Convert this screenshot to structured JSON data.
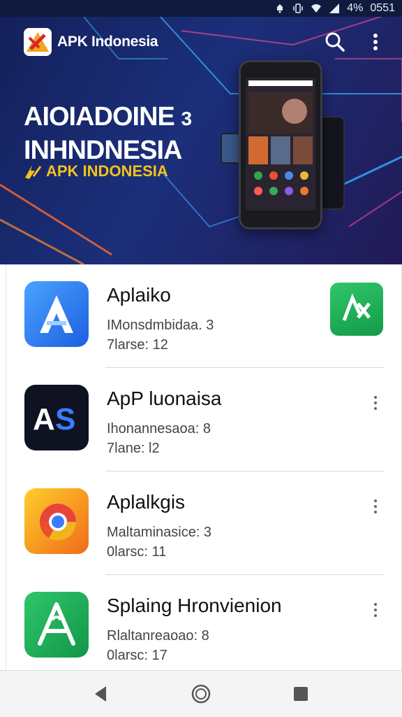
{
  "status_bar": {
    "battery": "4%",
    "time": "0551",
    "icons": [
      "notification-icon",
      "vibrate-icon",
      "wifi-icon",
      "signal-icon"
    ]
  },
  "app_bar": {
    "title": "APK Indonesia",
    "icons": [
      "search-icon",
      "more-vert-icon"
    ]
  },
  "banner": {
    "line1": "AIOIADOINE",
    "line1_suffix": "3",
    "line2": "INHNDNESIA",
    "line3": "APK INDONESIA"
  },
  "apps": [
    {
      "title": "Aplaiko",
      "line1": "IMonsdmbidaa. 3",
      "line2": "7larse: 12",
      "action": "download-badge",
      "icon": "arrow-a-icon"
    },
    {
      "title": "ApP luonaisa",
      "line1": "Ihonannesaoa: 8",
      "line2": "7lane: l2",
      "action": "more",
      "icon": "as-logo-icon"
    },
    {
      "title": "Aplalkgis",
      "line1": "Maltaminasice: 3",
      "line2": "0larsc: 11",
      "action": "more",
      "icon": "chrome-icon"
    },
    {
      "title": "Splaing Hronvienion",
      "line1": "Rlaltanreaoao: 8",
      "line2": "0larsc: 17",
      "action": "more",
      "icon": "a-tripod-icon"
    }
  ],
  "colors": {
    "banner_bg": "#1b2f7a",
    "accent_yellow": "#f5c21a",
    "green": "#1faa55",
    "blue": "#2d7ff9"
  },
  "nav": [
    "back-icon",
    "home-icon",
    "recents-icon"
  ]
}
